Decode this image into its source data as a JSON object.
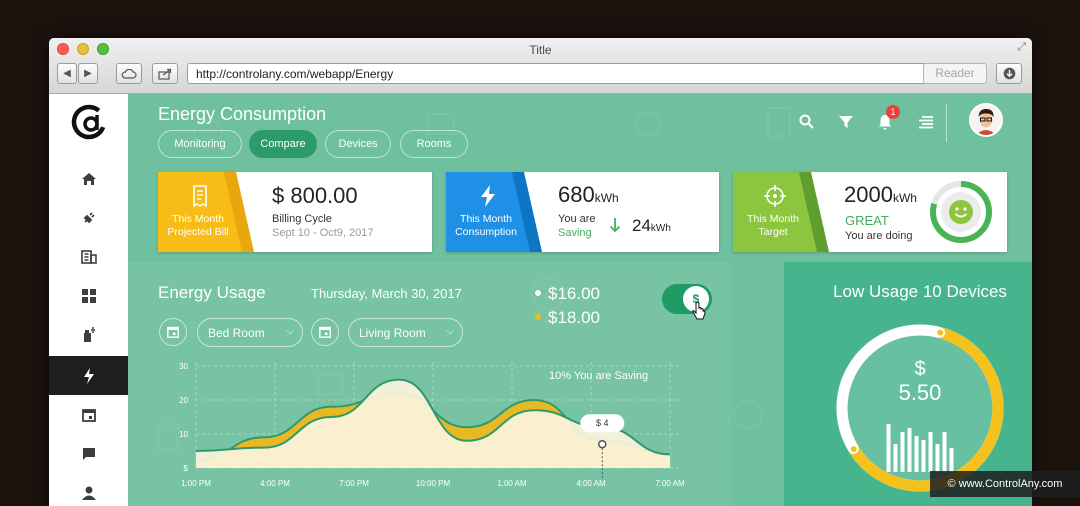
{
  "window": {
    "title": "Title"
  },
  "browser": {
    "url": "http://controlany.com/webapp/Energy",
    "reader": "Reader"
  },
  "sidebar": {
    "items": [
      "home",
      "plug",
      "building",
      "grid",
      "spray",
      "bolt",
      "calendar",
      "chat",
      "user"
    ]
  },
  "header": {
    "title": "Energy Consumption",
    "tabs": [
      "Monitoring",
      "Compare",
      "Devices",
      "Rooms"
    ],
    "active_tab": "Compare",
    "notification_count": "1"
  },
  "cards": {
    "bill": {
      "tab_line1": "This Month",
      "tab_line2": "Projected Bill",
      "value": "$ 800.00",
      "label": "Billing Cycle",
      "sub": "Sept 10 - Oct9, 2017",
      "color": "#f7bd16"
    },
    "consumption": {
      "tab_line1": "This Month",
      "tab_line2": "Consumption",
      "value": "680",
      "unit": "kWh",
      "label1": "You are",
      "label2": "Saving",
      "saving_value": "24",
      "saving_unit": "kWh",
      "color": "#1e90e6"
    },
    "target": {
      "tab_line1": "This Month",
      "tab_line2": "Target",
      "value": "2000",
      "unit": "kWh",
      "status": "GREAT",
      "sub": "You are doing",
      "color": "#8cc63f"
    }
  },
  "usage": {
    "title": "Energy Usage",
    "date": "Thursday, March 30, 2017",
    "room1": "Bed Room",
    "room2": "Living Room",
    "price1": "$16.00",
    "price2": "$18.00",
    "saving_pct": "10%",
    "saving_text": "You are Saving",
    "toggle_symbol": "$",
    "tooltip": "$ 4"
  },
  "chart_data": {
    "type": "area",
    "x": [
      "1:00 PM",
      "4:00 PM",
      "7:00 PM",
      "10:00 PM",
      "1:00 AM",
      "4:00 AM",
      "7:00 AM"
    ],
    "yticks": [
      "$",
      "10",
      "20",
      "30"
    ],
    "ylim": [
      0,
      30
    ],
    "series": [
      {
        "values": [
          2,
          9,
          18,
          22,
          12,
          20,
          8,
          4
        ],
        "color": "#e8b923"
      },
      {
        "values": [
          5,
          6,
          15,
          26,
          8,
          17,
          12,
          4
        ],
        "color": "#fbf3dc"
      }
    ]
  },
  "low_usage": {
    "title": "Low Usage 10 Devices",
    "currency": "$",
    "value": "5.50",
    "bars": [
      0.6,
      0.35,
      0.5,
      0.55,
      0.45,
      0.4,
      0.5,
      0.35,
      0.5,
      0.3
    ],
    "progress": 0.62
  },
  "watermark": "© www.ControlAny.com"
}
